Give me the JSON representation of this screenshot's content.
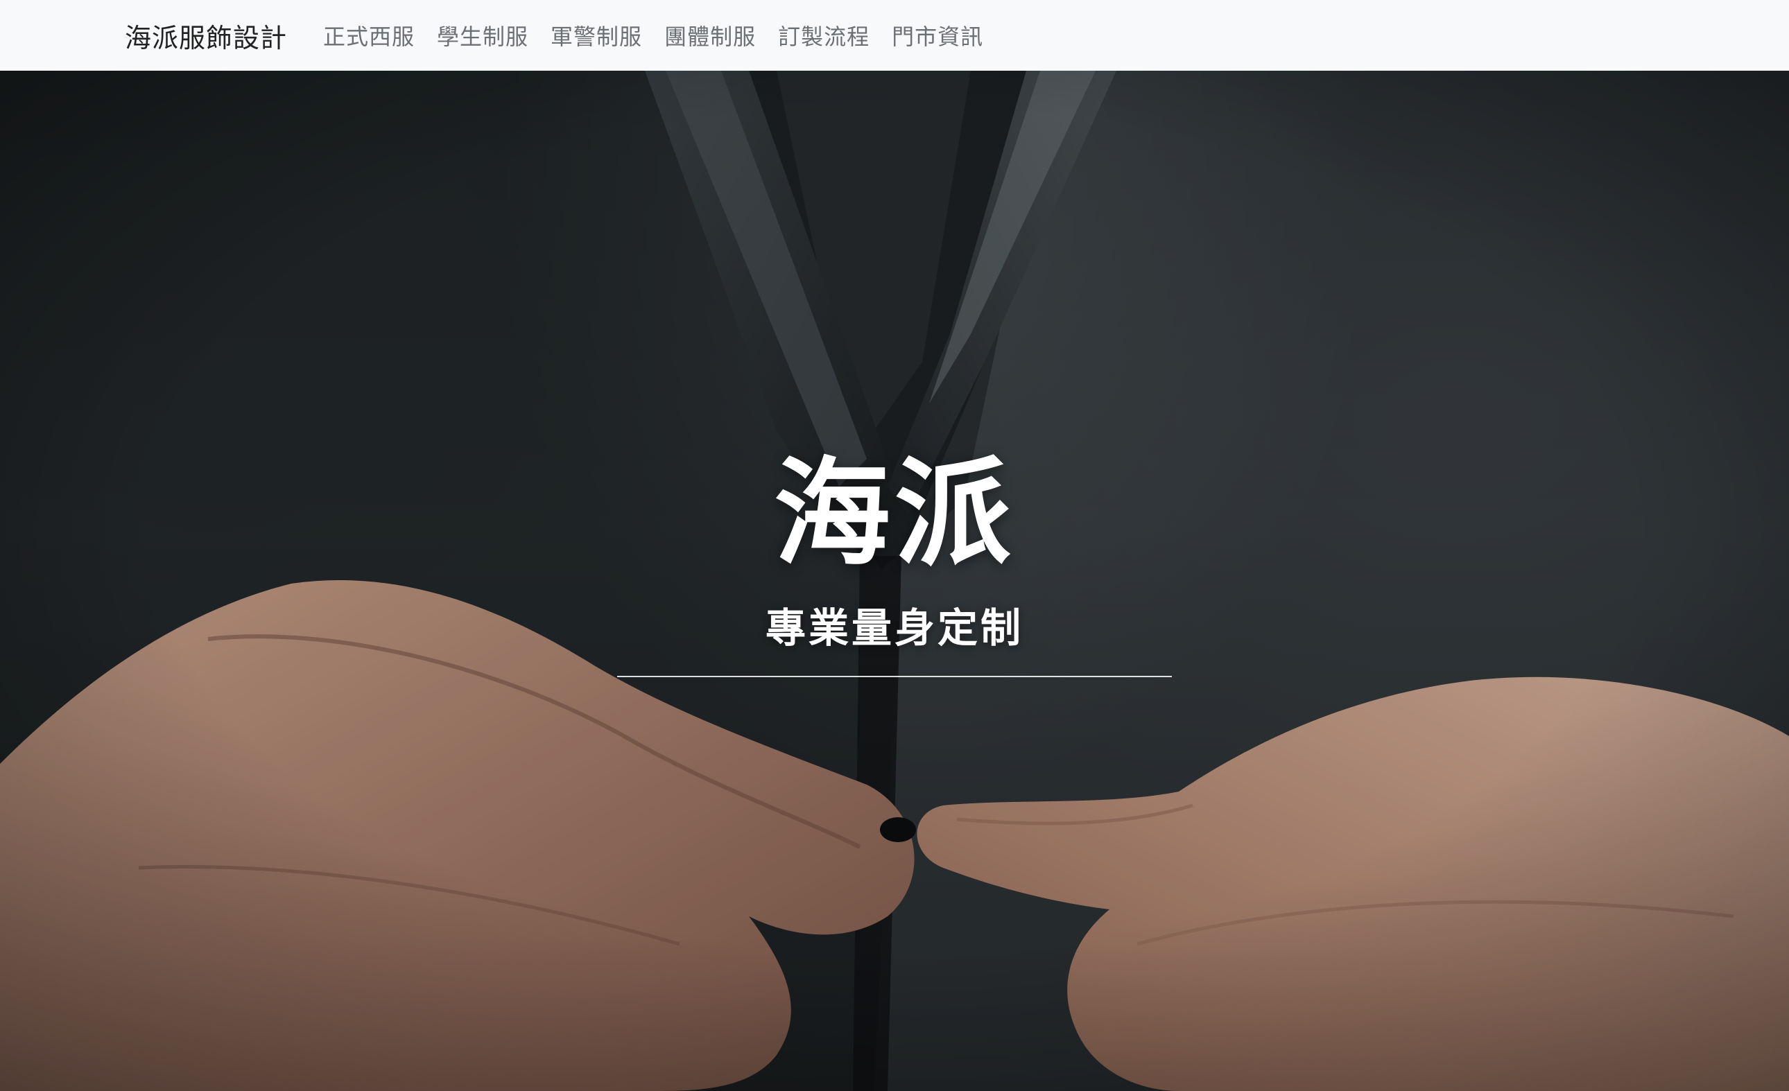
{
  "navbar": {
    "brand": "海派服飾設計",
    "links": [
      {
        "label": "正式西服"
      },
      {
        "label": "學生制服"
      },
      {
        "label": "軍警制服"
      },
      {
        "label": "團體制服"
      },
      {
        "label": "訂製流程"
      },
      {
        "label": "門市資訊"
      }
    ]
  },
  "hero": {
    "title": "海派",
    "subtitle": "專業量身定制",
    "image_subject": "person in dark suit buttoning jacket"
  },
  "colors": {
    "navbar_bg": "#f8f9fa",
    "brand_text": "#222222",
    "nav_link_text": "#6c6f73",
    "hero_text": "#ffffff",
    "suit_fabric": "#2b3033"
  }
}
